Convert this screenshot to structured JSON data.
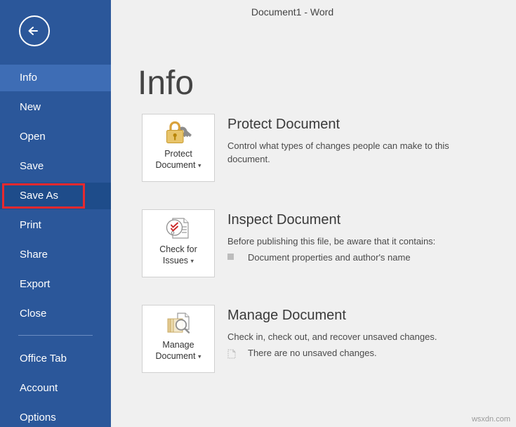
{
  "window": {
    "title": "Document1 - Word"
  },
  "sidebar": {
    "back_icon": "back-arrow-icon",
    "items": [
      {
        "label": "Info",
        "state": "active"
      },
      {
        "label": "New",
        "state": "normal"
      },
      {
        "label": "Open",
        "state": "normal"
      },
      {
        "label": "Save",
        "state": "normal"
      },
      {
        "label": "Save As",
        "state": "pressed"
      },
      {
        "label": "Print",
        "state": "normal"
      },
      {
        "label": "Share",
        "state": "normal"
      },
      {
        "label": "Export",
        "state": "normal"
      },
      {
        "label": "Close",
        "state": "normal"
      },
      {
        "label": "Office Tab",
        "state": "normal"
      },
      {
        "label": "Account",
        "state": "normal"
      },
      {
        "label": "Options",
        "state": "normal"
      }
    ],
    "highlight": {
      "target": "Save As",
      "color": "#e8292f"
    }
  },
  "main": {
    "heading": "Info",
    "sections": [
      {
        "button_label_line1": "Protect",
        "button_label_line2": "Document",
        "button_caret": "▾",
        "button_icon": "padlock-key-icon",
        "title": "Protect Document",
        "description": "Control what types of changes people can make to this document.",
        "details": []
      },
      {
        "button_label_line1": "Check for",
        "button_label_line2": "Issues",
        "button_caret": "▾",
        "button_icon": "document-checkmark-icon",
        "title": "Inspect Document",
        "description": "Before publishing this file, be aware that it contains:",
        "details": [
          {
            "icon": "gray-square-bullet-icon",
            "text": "Document properties and author's name"
          }
        ]
      },
      {
        "button_label_line1": "Manage",
        "button_label_line2": "Document",
        "button_caret": "▾",
        "button_icon": "documents-magnifier-icon",
        "title": "Manage Document",
        "description": "Check in, check out, and recover unsaved changes.",
        "details": [
          {
            "icon": "dashed-page-icon",
            "text": "There are no unsaved changes."
          }
        ]
      }
    ]
  },
  "watermark": "wsxdn.com",
  "colors": {
    "sidebar": "#2b579a",
    "sidebar_active": "#3e6db5",
    "sidebar_pressed": "#1e4c8a",
    "highlight": "#e8292f",
    "pane": "#f0f0f0"
  }
}
